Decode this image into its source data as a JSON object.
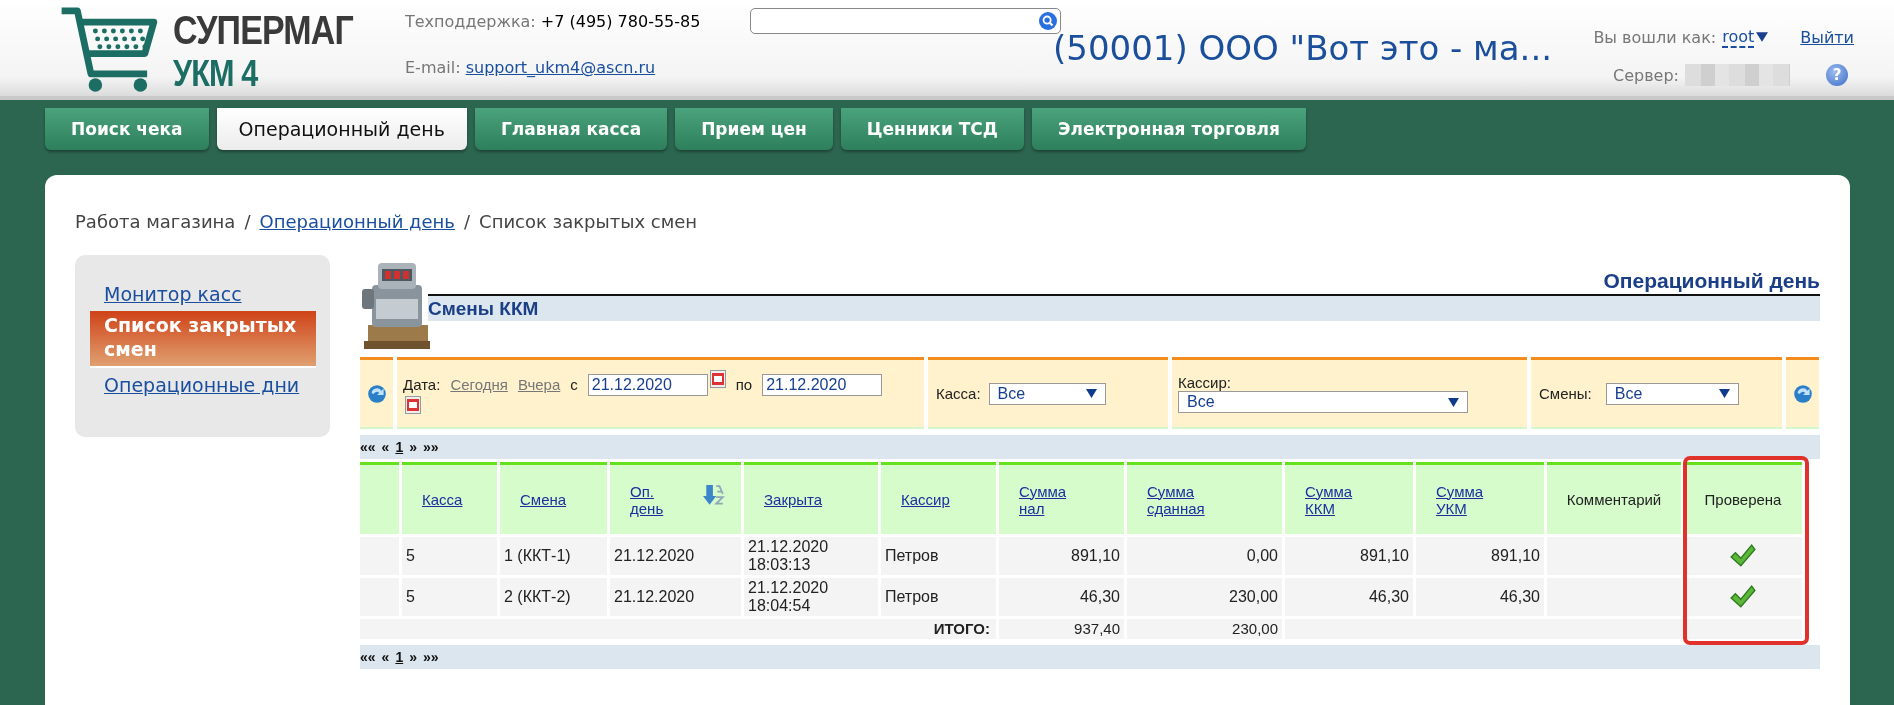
{
  "header": {
    "logo": {
      "line1": "СУПЕРМАГ",
      "line2": "УКМ 4"
    },
    "support_label": "Техподдержка:",
    "support_phone": "+7 (495) 780-55-85",
    "email_label": "E-mail:",
    "email": "support_ukm4@ascn.ru",
    "store_title": "(50001) ООО \"Вот это - ма...",
    "login_label": "Вы вошли как:",
    "user": "root",
    "logout": "Выйти",
    "server_label": "Сервер:",
    "help": "?"
  },
  "tabs": [
    {
      "label": "Поиск чека",
      "selected": false
    },
    {
      "label": "Операционный день",
      "selected": true
    },
    {
      "label": "Главная касса",
      "selected": false
    },
    {
      "label": "Прием цен",
      "selected": false
    },
    {
      "label": "Ценники ТСД",
      "selected": false
    },
    {
      "label": "Электронная торговля",
      "selected": false
    }
  ],
  "breadcrumb": {
    "items": [
      {
        "label": "Работа магазина",
        "link": false
      },
      {
        "label": "Операционный день",
        "link": true
      },
      {
        "label": "Список закрытых смен",
        "link": false
      }
    ],
    "separators": [
      "/",
      "/"
    ]
  },
  "sidebar": {
    "items": [
      {
        "label": "Монитор касс",
        "selected": false
      },
      {
        "label": "Список закрытых смен",
        "selected": true
      },
      {
        "label": "Операционные дни",
        "selected": false
      }
    ]
  },
  "section": {
    "title": "Операционный день",
    "subtitle": "Смены ККМ"
  },
  "filters": {
    "date_label": "Дата:",
    "quick_links": [
      "Сегодня",
      "Вчера"
    ],
    "from_label": "с",
    "from": "21.12.2020",
    "to_label": "по",
    "to": "21.12.2020",
    "kassa": {
      "label": "Касса:",
      "value": "Все"
    },
    "cashier": {
      "label": "Кассир:",
      "value": "Все"
    },
    "shifts": {
      "label": "Смены:",
      "value": "Все"
    }
  },
  "pager_top": {
    "first": "««",
    "prev": "«",
    "page": "1",
    "next": "»",
    "last": "»»"
  },
  "table": {
    "columns": [
      {
        "label": "Касса",
        "link": true,
        "sorted": false,
        "highlighted": false
      },
      {
        "label": "Смена",
        "link": true,
        "sorted": false,
        "highlighted": false
      },
      {
        "label": "Оп.\nдень",
        "link": true,
        "sorted": true,
        "highlighted": false
      },
      {
        "label": "Закрыта",
        "link": true,
        "sorted": false,
        "highlighted": false
      },
      {
        "label": "Кассир",
        "link": true,
        "sorted": false,
        "highlighted": false
      },
      {
        "label": "Сумма\nнал",
        "link": true,
        "sorted": false,
        "highlighted": false
      },
      {
        "label": "Сумма\nсданная",
        "link": true,
        "sorted": false,
        "highlighted": false
      },
      {
        "label": "Сумма\nККМ",
        "link": true,
        "sorted": false,
        "highlighted": false
      },
      {
        "label": "Сумма\nУКМ",
        "link": true,
        "sorted": false,
        "highlighted": false
      },
      {
        "label": "Комментарий",
        "link": false,
        "sorted": false,
        "highlighted": false
      },
      {
        "label": "Проверена",
        "link": false,
        "sorted": false,
        "highlighted": true
      }
    ],
    "rows": [
      {
        "cells": [
          "5",
          "1 (ККТ-1)",
          "21.12.2020",
          "21.12.2020\n18:03:13",
          "Петров",
          "891,10",
          "0,00",
          "891,10",
          "891,10"
        ],
        "verified": true
      },
      {
        "cells": [
          "5",
          "2 (ККТ-2)",
          "21.12.2020",
          "21.12.2020\n18:04:54",
          "Петров",
          "46,30",
          "230,00",
          "46,30",
          "46,30"
        ],
        "verified": true
      }
    ],
    "totals": {
      "label": "ИТОГО:",
      "values": [
        "937,40",
        "230,00"
      ]
    }
  },
  "pager_bottom": {
    "first": "««",
    "prev": "«",
    "page": "1",
    "next": "»",
    "last": "»»"
  }
}
